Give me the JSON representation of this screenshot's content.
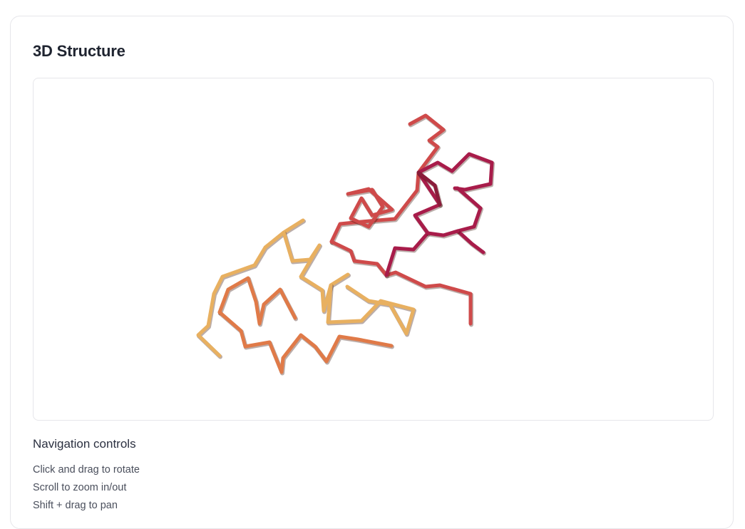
{
  "card": {
    "title": "3D Structure"
  },
  "viewer": {
    "description_icon": "protein-backbone-render",
    "colors": {
      "gold": "#e8b060",
      "orange": "#e07a48",
      "red": "#cf4a4a",
      "crimson": "#a81c4a",
      "maroon": "#8a1c3a"
    }
  },
  "navigation": {
    "title": "Navigation controls",
    "items": [
      "Click and drag to rotate",
      "Scroll to zoom in/out",
      "Shift + drag to pan"
    ]
  }
}
